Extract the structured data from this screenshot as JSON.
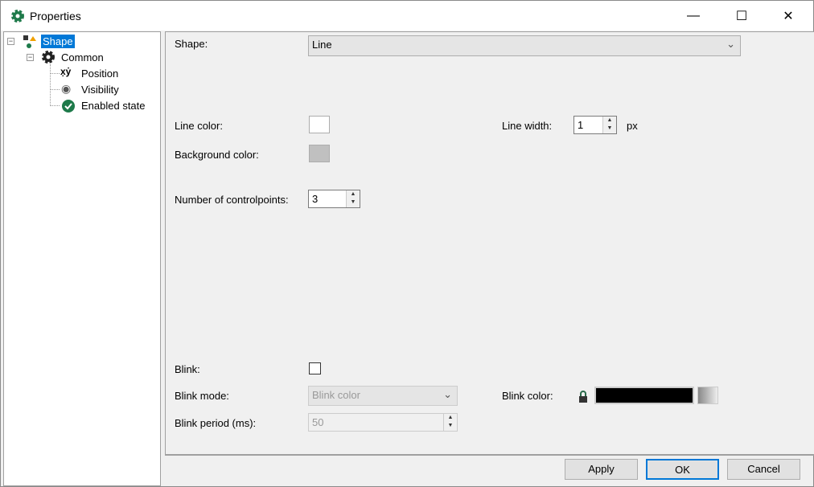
{
  "window": {
    "title": "Properties",
    "minimize": "—",
    "maximize": "☐",
    "close": "✕"
  },
  "tree": {
    "root": "Shape",
    "common": "Common",
    "children": [
      "Position",
      "Visibility",
      "Enabled state"
    ]
  },
  "form": {
    "shape_label": "Shape:",
    "shape_value": "Line",
    "line_color_label": "Line color:",
    "line_color": "#ffffff",
    "bg_color_label": "Background color:",
    "bg_color": "#c0c0c0",
    "line_width_label": "Line width:",
    "line_width": "1",
    "line_width_unit": "px",
    "controlpoints_label": "Number of controlpoints:",
    "controlpoints": "3",
    "blink_label": "Blink:",
    "blink_checked": false,
    "blink_mode_label": "Blink mode:",
    "blink_mode": "Blink color",
    "blink_color_label": "Blink color:",
    "blink_color": "#000000",
    "blink_period_label": "Blink period (ms):",
    "blink_period": "50"
  },
  "buttons": {
    "apply": "Apply",
    "ok": "OK",
    "cancel": "Cancel"
  }
}
